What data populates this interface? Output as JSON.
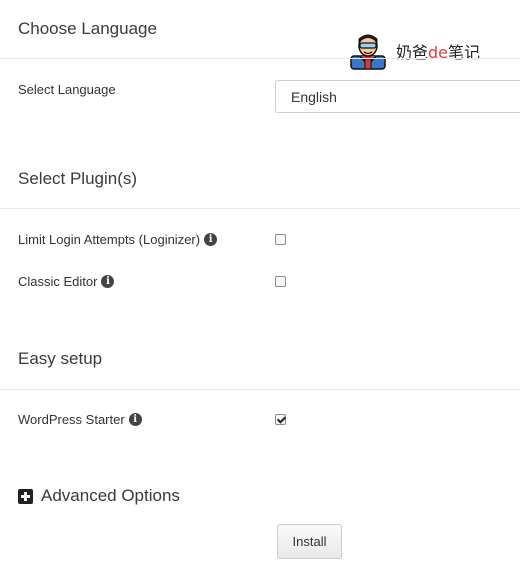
{
  "language_section": {
    "title": "Choose Language",
    "select_label": "Select Language",
    "selected_language": "English"
  },
  "plugins_section": {
    "title": "Select Plugin(s)",
    "items": [
      {
        "label": "Limit Login Attempts (Loginizer)",
        "checked": false
      },
      {
        "label": "Classic Editor",
        "checked": false
      }
    ]
  },
  "easy_setup_section": {
    "title": "Easy setup",
    "items": [
      {
        "label": "WordPress Starter",
        "checked": true
      }
    ]
  },
  "advanced": {
    "label": "Advanced Options"
  },
  "install_button": {
    "label": "Install"
  },
  "watermark": {
    "text_before": "奶爸",
    "text_red": "de",
    "text_after": "笔记"
  }
}
